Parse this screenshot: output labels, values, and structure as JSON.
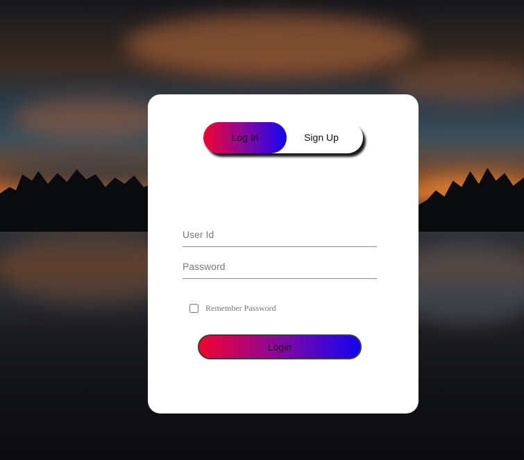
{
  "auth_toggle": {
    "login_label": "Log In",
    "signup_label": "Sign Up",
    "active": "Log In"
  },
  "form": {
    "userid_placeholder": "User Id",
    "userid_value": "",
    "password_placeholder": "Password",
    "password_value": "",
    "remember_label": "Remember Password",
    "remember_checked": false,
    "submit_label": "Login"
  },
  "colors": {
    "gradient_start": "#f2032f",
    "gradient_mid": "#7a08a8",
    "gradient_end": "#1204f2",
    "card_background": "#ffffff"
  }
}
